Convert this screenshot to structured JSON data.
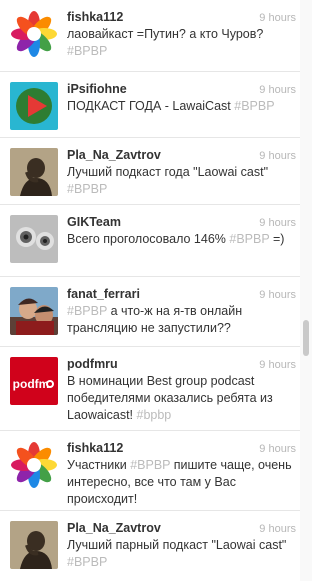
{
  "tweets": [
    {
      "author": "fishka112",
      "time": "9 hours",
      "avatar_icon": "flower-logo-icon",
      "text": "лаовайкаст =Путин? а кто Чуров?",
      "hashtag": "#BPBP"
    },
    {
      "author": "iPsifiohne",
      "time": "9 hours",
      "avatar_icon": "play-button-icon",
      "text": "ПОДКАСТ ГОДА - LawaiCast",
      "hashtag": "#BPBP"
    },
    {
      "author": "Pla_Na_Zavtrov",
      "time": "9 hours",
      "avatar_icon": "person-silhouette-icon",
      "text": "Лучший подкаст года \"Laowai cast\"",
      "hashtag": "#BPBP"
    },
    {
      "author": "GIKTeam",
      "time": "9 hours",
      "avatar_icon": "speaker-grille-icon",
      "text": "Всего проголосовало 146%",
      "hashtag": "#BPBP",
      "text_after": "=)"
    },
    {
      "author": "fanat_ferrari",
      "time": "9 hours",
      "avatar_icon": "user-photo-icon",
      "hashtag_before": "#BPBP",
      "text": "а что-ж на я-тв онлайн трансляцию не запустили??"
    },
    {
      "author": "podfmru",
      "time": "9 hours",
      "avatar_icon": "podfm-logo-icon",
      "avatar_logo_text": "podfm",
      "text": "В номинации Best group podcast победителями оказались ребята из Laowaicast!",
      "hashtag": "#bpbp"
    },
    {
      "author": "fishka112",
      "time": "9 hours",
      "avatar_icon": "flower-logo-icon",
      "hashtag_before": "#BPBP",
      "text": "Участники #BPBP пишите чаще, очень интересно, все что там у Вас происходит!"
    },
    {
      "author": "Pla_Na_Zavtrov",
      "time": "9 hours",
      "avatar_icon": "person-silhouette-icon",
      "text": "Лучший парный подкаст \"Laowai cast\"",
      "hashtag": "#BPBP"
    }
  ],
  "colors": {
    "text": "#333333",
    "muted": "#b7b7b7",
    "hashtag": "#bbbbbb",
    "divider": "#e6e6e6",
    "podfm_red": "#d0021b"
  }
}
